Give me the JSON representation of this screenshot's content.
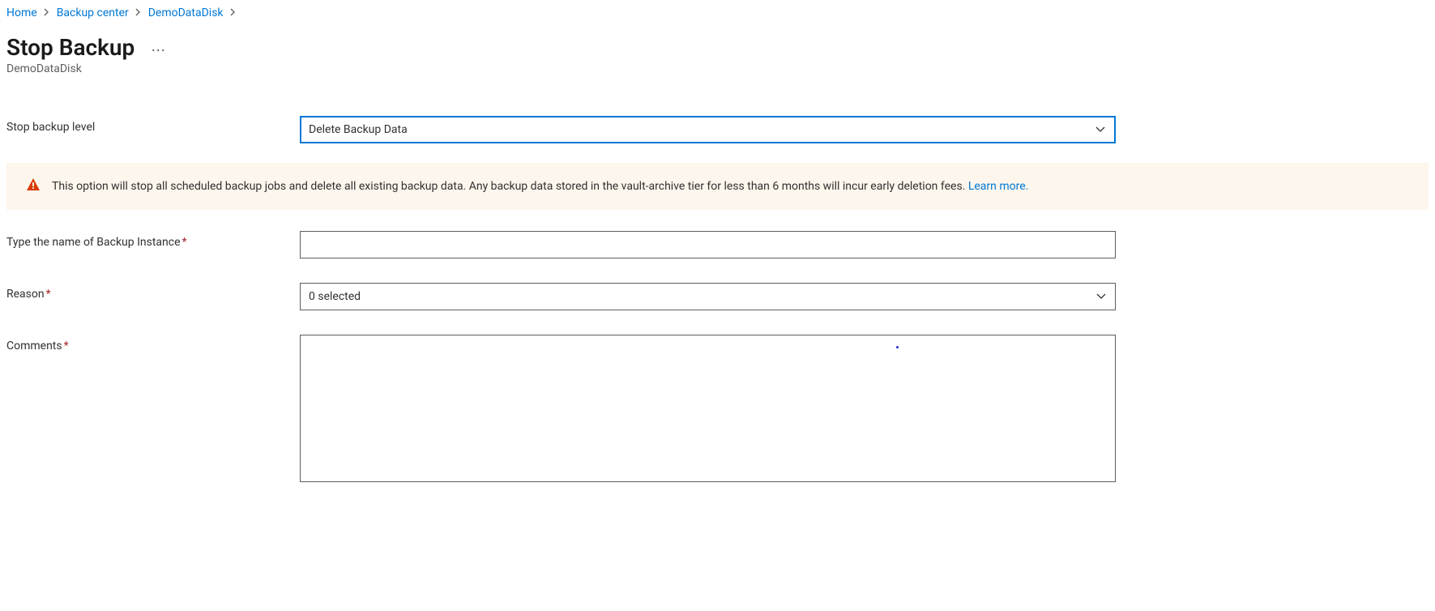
{
  "breadcrumb": {
    "items": [
      {
        "label": "Home"
      },
      {
        "label": "Backup center"
      },
      {
        "label": "DemoDataDisk"
      }
    ]
  },
  "page": {
    "title": "Stop Backup",
    "subtitle": "DemoDataDisk"
  },
  "form": {
    "stopBackupLevel": {
      "label": "Stop backup level",
      "value": "Delete Backup Data"
    },
    "warning": {
      "text": "This option will stop all scheduled backup jobs and delete all existing backup data. Any backup data stored in the vault-archive tier for less than 6 months will incur early deletion fees. ",
      "linkText": "Learn more."
    },
    "backupInstanceName": {
      "label": "Type the name of Backup Instance",
      "value": ""
    },
    "reason": {
      "label": "Reason",
      "value": "0 selected"
    },
    "comments": {
      "label": "Comments",
      "value": ""
    }
  }
}
